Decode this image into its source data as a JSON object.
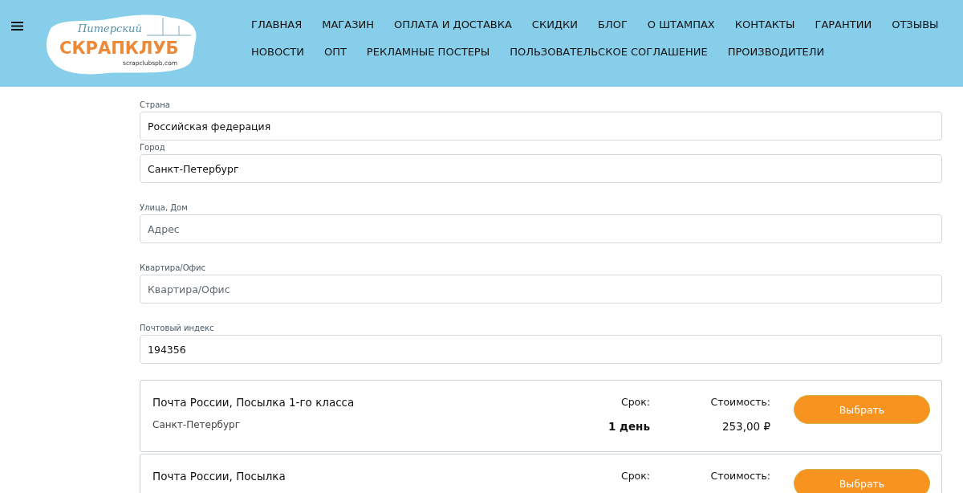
{
  "header": {
    "logo": {
      "script_line": "Питерский",
      "name": "СКРАПКЛУБ",
      "domain": "scrapclubspb.com"
    },
    "nav_rows": [
      [
        "ГЛАВНАЯ",
        "МАГАЗИН",
        "ОПЛАТА И ДОСТАВКА",
        "СКИДКИ",
        "БЛОГ",
        "О ШТАМПАХ",
        "КОНТАКТЫ",
        "ГАРАНТИИ",
        "ОТЗЫВЫ"
      ],
      [
        "НОВОСТИ",
        "ОПТ",
        "РЕКЛАМНЫЕ ПОСТЕРЫ",
        "ПОЛЬЗОВАТЕЛЬСКОЕ СОГЛАШЕНИЕ",
        "ПРОИЗВОДИТЕЛИ"
      ]
    ]
  },
  "form": {
    "fields": [
      {
        "label": "Страна",
        "value": "Российская федерация"
      },
      {
        "label": "Город",
        "value": "Санкт-Петербург"
      },
      {
        "label": "Улица, Дом",
        "placeholder": "Адрес"
      },
      {
        "label": "Квартира/Офис",
        "placeholder": "Квартира/Офис"
      },
      {
        "label": "Почтовый индекс",
        "value": "194356"
      }
    ]
  },
  "delivery_options": [
    {
      "name": "Почта России, Посылка 1-го класса",
      "city": "Санкт-Петербург",
      "term_label": "Срок:",
      "term": "1 день",
      "cost_label": "Стоимость:",
      "cost": "253,00 ₽",
      "button": "Выбрать"
    },
    {
      "name": "Почта России, Посылка",
      "term_label": "Срок:",
      "cost_label": "Стоимость:",
      "button": "Выбрать"
    }
  ]
}
